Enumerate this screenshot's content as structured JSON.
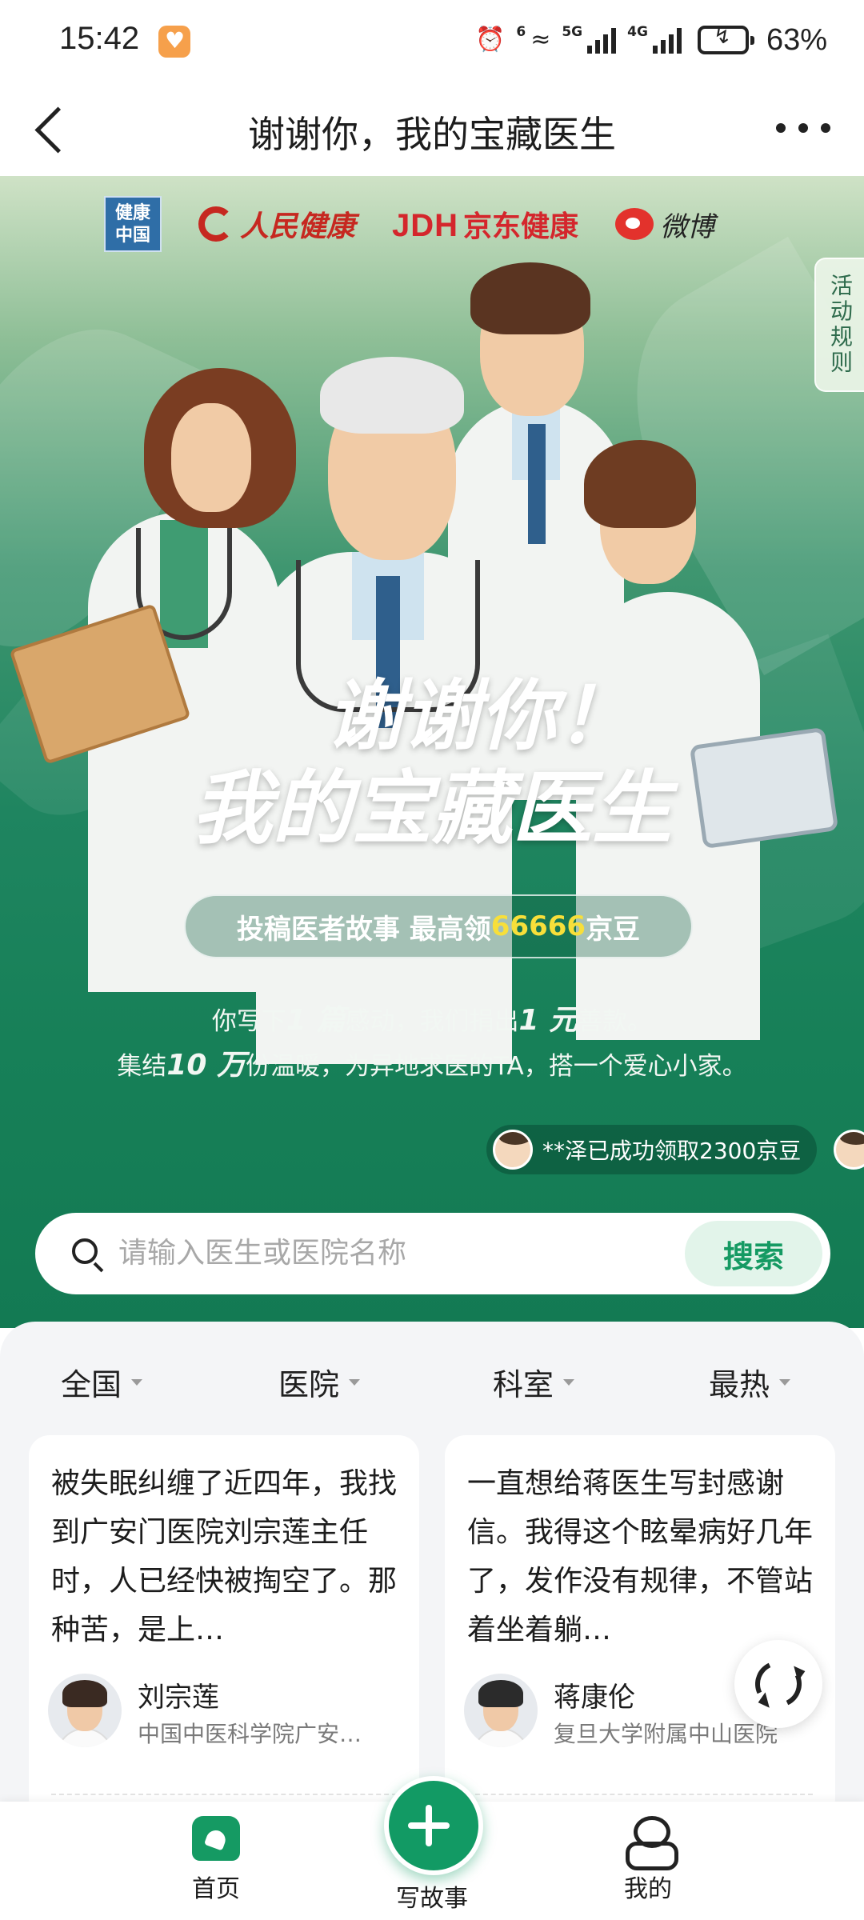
{
  "status_bar": {
    "time": "15:42",
    "network_5g": "5G",
    "network_4g": "4G",
    "wifi_badge": "6",
    "battery_percent": "63%",
    "icons": [
      "app-notification-icon",
      "alarm-icon",
      "wifi-icon",
      "signal-icon",
      "battery-charging-icon"
    ]
  },
  "nav": {
    "title": "谢谢你，我的宝藏医生",
    "back_icon": "chevron-left-icon",
    "more_icon": "more-dots-icon"
  },
  "hero": {
    "partners": [
      "健康中国",
      "人民健康",
      "京东健康",
      "微博"
    ],
    "partner_jkzg_line1": "健康",
    "partner_jkzg_line2": "中国",
    "partner_rmjk": "人民健康",
    "partner_jd_logo": "JDH",
    "partner_jd": "京东健康",
    "partner_wb": "微博",
    "rules_tab": "活动规则",
    "title_line1": "谢谢你！",
    "title_line2": "我的宝藏医生",
    "pill_prefix": "投稿医者故事 最高领",
    "pill_highlight": "66666",
    "pill_suffix": "京豆",
    "desc1_a": "你写下",
    "desc1_b": "1 篇",
    "desc1_c": "感动，我们捐出",
    "desc1_d": "1 元",
    "desc1_e": "善款。",
    "desc2_a": "集结",
    "desc2_b": "10 万",
    "desc2_c": "份温暖，为异地求医的TA，搭一个爱心小家。",
    "ticker": "**泽已成功领取2300京豆",
    "accent_color": "#159a63",
    "highlight_color": "#f7df3a"
  },
  "search": {
    "placeholder": "请输入医生或医院名称",
    "value": "",
    "button_label": "搜索"
  },
  "filters": [
    "全国",
    "医院",
    "科室",
    "最热"
  ],
  "cards": [
    {
      "text": "被失眠纠缠了近四年，我找到广安门医院刘宗莲主任时，人已经快被掏空了。那种苦，是上…",
      "doctor_name": "刘宗莲",
      "hospital": "中国中医科学院广安…"
    },
    {
      "text": "一直想给蒋医生写封感谢信。我得这个眩晕病好几年了，发作没有规律，不管站着坐着躺…",
      "doctor_name": "蒋康伦",
      "hospital": "复旦大学附属中山医院"
    }
  ],
  "tab_bar": {
    "home": "首页",
    "write": "写故事",
    "me": "我的"
  }
}
